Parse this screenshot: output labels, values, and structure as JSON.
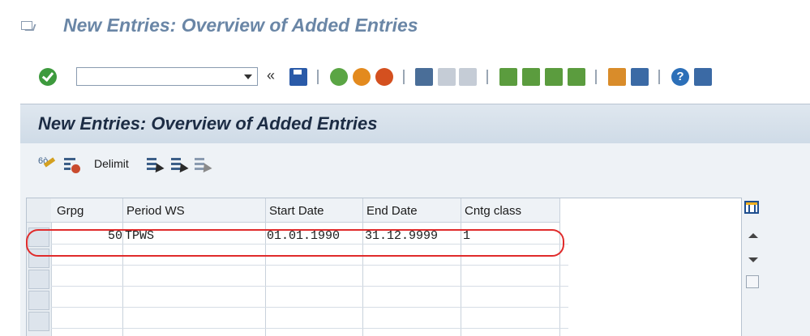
{
  "window": {
    "title": "New Entries: Overview of Added Entries"
  },
  "toolbar": {
    "command_field_value": "",
    "back_glyph": "«",
    "help_glyph": "?"
  },
  "screen": {
    "title": "New Entries: Overview of Added Entries",
    "delimit_label": "Delimit"
  },
  "table": {
    "headers": [
      "Grpg",
      "Period WS",
      "Start Date",
      "End Date",
      "Cntg class"
    ],
    "rows": [
      {
        "grpg": "50",
        "period_ws": "TPWS",
        "start_date": "01.01.1990",
        "end_date": "31.12.9999",
        "cntg_class": "1"
      }
    ]
  },
  "colors": {
    "title_blue": "#6a86a6",
    "highlight_red": "#e02b2b",
    "ok_green": "#3d9a3d"
  }
}
